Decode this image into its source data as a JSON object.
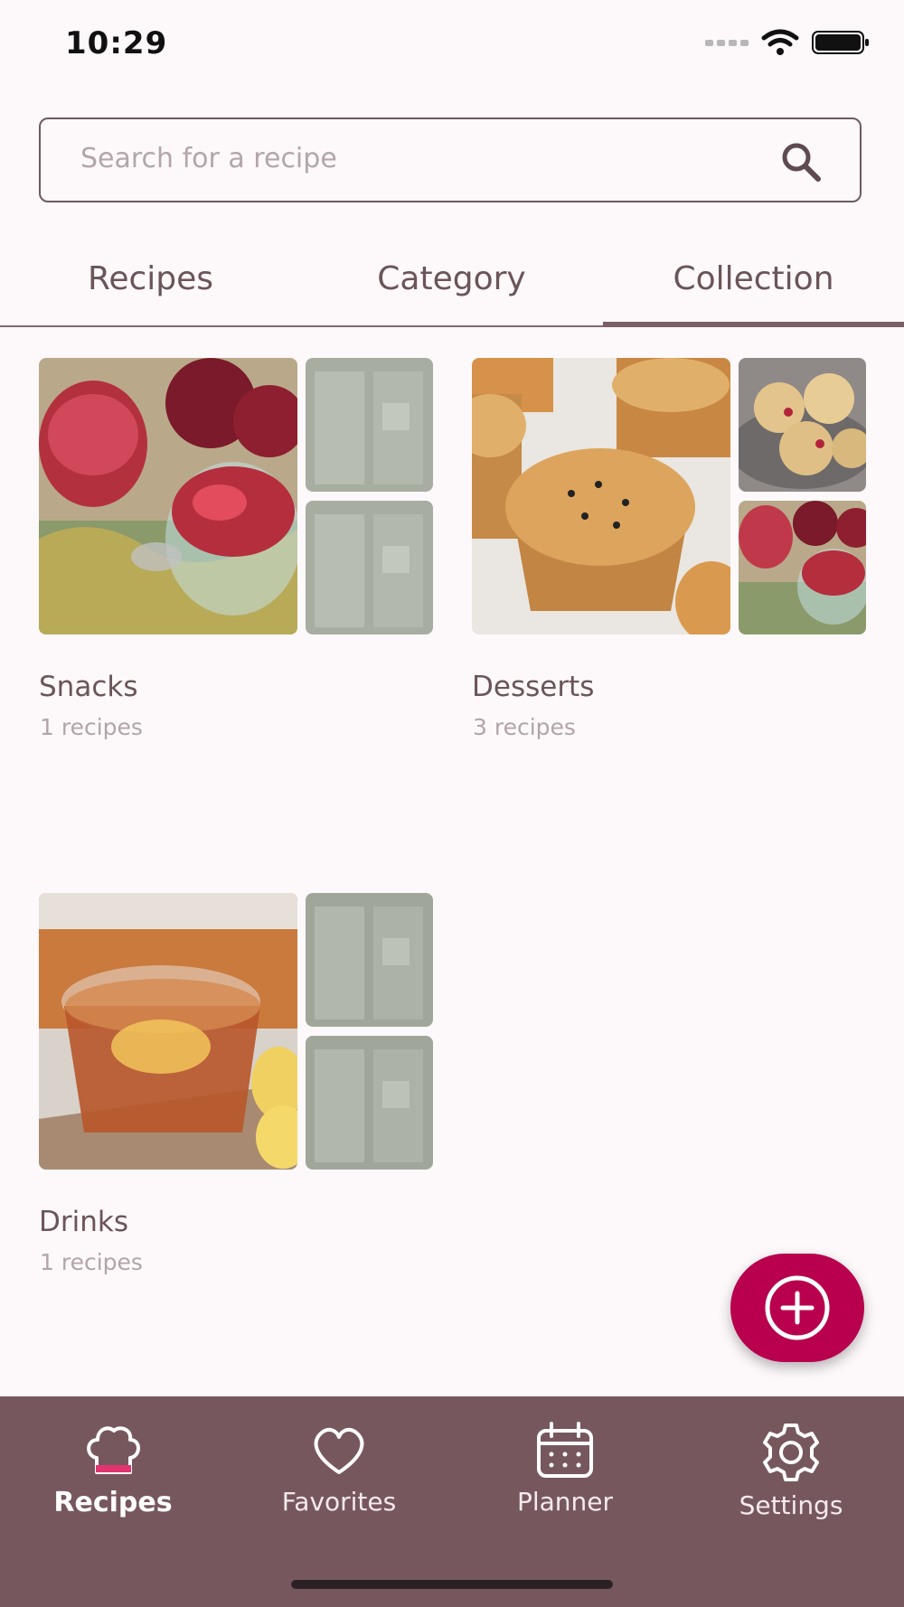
{
  "status_bar": {
    "time": "10:29",
    "icons": [
      "signal-icon",
      "wifi-icon",
      "battery-icon"
    ]
  },
  "search": {
    "placeholder": "Search for a recipe",
    "icon": "search-icon"
  },
  "tabs": [
    {
      "label": "Recipes",
      "selected": false
    },
    {
      "label": "Category",
      "selected": false
    },
    {
      "label": "Collection",
      "selected": true
    }
  ],
  "collections": [
    {
      "title": "Snacks",
      "count": "1 recipes"
    },
    {
      "title": "Desserts",
      "count": "3 recipes"
    },
    {
      "title": "Drinks",
      "count": "1 recipes"
    }
  ],
  "fab": {
    "icon": "add-circle-icon"
  },
  "bottom_nav": [
    {
      "label": "Recipes",
      "icon": "chef-hat-icon",
      "active": true
    },
    {
      "label": "Favorites",
      "icon": "heart-icon",
      "active": false
    },
    {
      "label": "Planner",
      "icon": "calendar-icon",
      "active": false
    },
    {
      "label": "Settings",
      "icon": "gear-icon",
      "active": false
    }
  ],
  "colors": {
    "accent": "#b8004e",
    "nav_background": "#77575e",
    "text": "#6a5559",
    "background": "#fdf8fa"
  }
}
